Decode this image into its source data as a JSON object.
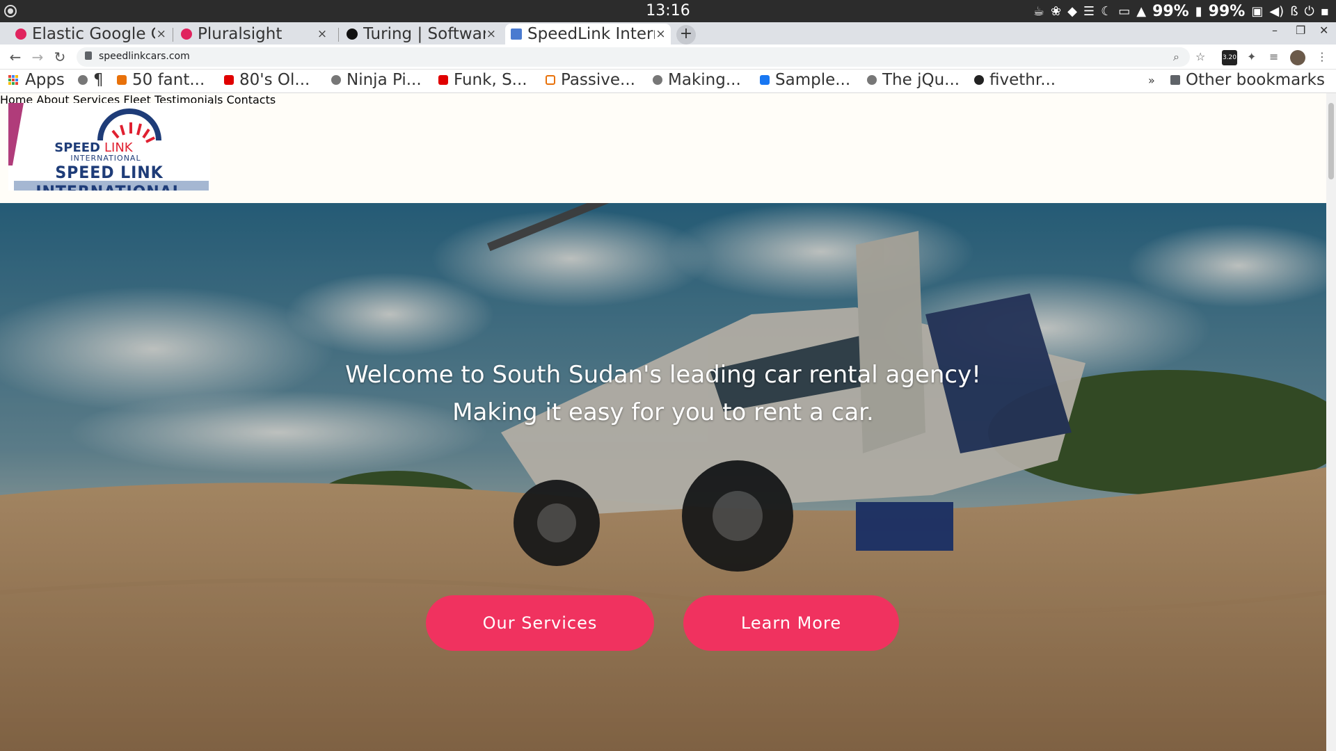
{
  "os": {
    "clock": "13:16",
    "battery_1": "99%",
    "battery_2": "99%"
  },
  "browser": {
    "tabs": [
      {
        "title": "Elastic Google Cl",
        "favicon_color": "#e0245e"
      },
      {
        "title": "Pluralsight",
        "favicon_color": "#e0245e"
      },
      {
        "title": "Turing | Software",
        "favicon_color": "#111111"
      },
      {
        "title": "SpeedLink Intern",
        "favicon_color": "#4a7bd0"
      }
    ],
    "new_tab": "+",
    "url": "speedlinkcars.com",
    "extension_badge": "3.20",
    "bookmarks": [
      {
        "label": "Apps",
        "icon": "apps-grid-icon"
      },
      {
        "label": "¶",
        "icon": "globe-icon"
      },
      {
        "label": "50 fant...",
        "icon": "blogger-icon",
        "color": "#e8710a"
      },
      {
        "label": "80's Ol...",
        "icon": "youtube-icon",
        "color": "#e00000"
      },
      {
        "label": "Ninja Pi...",
        "icon": "globe-icon"
      },
      {
        "label": "Funk, S...",
        "icon": "youtube-icon",
        "color": "#e00000"
      },
      {
        "label": "Passive...",
        "icon": "chip-icon",
        "color": "#e8710a"
      },
      {
        "label": "Making...",
        "icon": "globe-icon"
      },
      {
        "label": "Sample...",
        "icon": "facebook-icon",
        "color": "#1877f2"
      },
      {
        "label": "The jQu...",
        "icon": "globe-icon"
      },
      {
        "label": "fivethr...",
        "icon": "fivethirtyeight-icon"
      }
    ],
    "bookmarks_overflow": "»",
    "other_bookmarks": "Other bookmarks"
  },
  "site": {
    "logo": {
      "line1": "SPEED",
      "line1b": "LINK",
      "line2": "INTERNATIONAL",
      "brand_main": "SPEED LINK INTERNATIONAL"
    },
    "nav": [
      "Home",
      "About",
      "Services",
      "Fleet",
      "Testimonials",
      "Contacts"
    ],
    "hero": {
      "line1": "Welcome to South Sudan's leading car rental agency!",
      "line2": "Making it easy for you to rent a car.",
      "primary_button": "Our Services",
      "secondary_button": "Learn More"
    },
    "colors": {
      "nav_link": "#2aa7c9",
      "button": "#f0325f"
    }
  }
}
